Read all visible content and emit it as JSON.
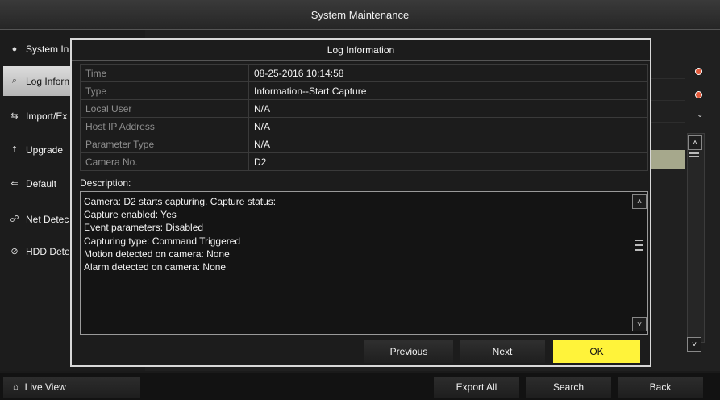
{
  "window": {
    "title": "System Maintenance"
  },
  "sidebar": {
    "items": [
      {
        "label": "System In",
        "icon": "info-icon"
      },
      {
        "label": "Log Inforn",
        "icon": "log-search-icon"
      },
      {
        "label": "Import/Ex",
        "icon": "import-export-icon"
      },
      {
        "label": "Upgrade",
        "icon": "upgrade-icon"
      },
      {
        "label": "Default",
        "icon": "default-icon"
      },
      {
        "label": "Net Detec",
        "icon": "net-detect-icon"
      },
      {
        "label": "HDD Dete",
        "icon": "hdd-detect-icon"
      }
    ]
  },
  "bottom": {
    "live_view": "Live View",
    "export_all": "Export All",
    "search": "Search",
    "back": "Back"
  },
  "modal": {
    "title": "Log Information",
    "fields": [
      {
        "label": "Time",
        "value": "08-25-2016 10:14:58"
      },
      {
        "label": "Type",
        "value": "Information--Start Capture"
      },
      {
        "label": "Local User",
        "value": "N/A"
      },
      {
        "label": "Host IP Address",
        "value": "N/A"
      },
      {
        "label": "Parameter Type",
        "value": "N/A"
      },
      {
        "label": "Camera No.",
        "value": "D2"
      }
    ],
    "description_label": "Description:",
    "description_lines": [
      "Camera: D2 starts capturing. Capture status:",
      "Capture enabled: Yes",
      "Event parameters: Disabled",
      "Capturing type: Command Triggered",
      "Motion detected on camera: None",
      "Alarm detected on camera: None"
    ],
    "buttons": {
      "previous": "Previous",
      "next": "Next",
      "ok": "OK"
    }
  },
  "colors": {
    "ok_button": "#fff33a",
    "status_dot": "#e25a3b",
    "selected_row": "#a6a88c"
  }
}
